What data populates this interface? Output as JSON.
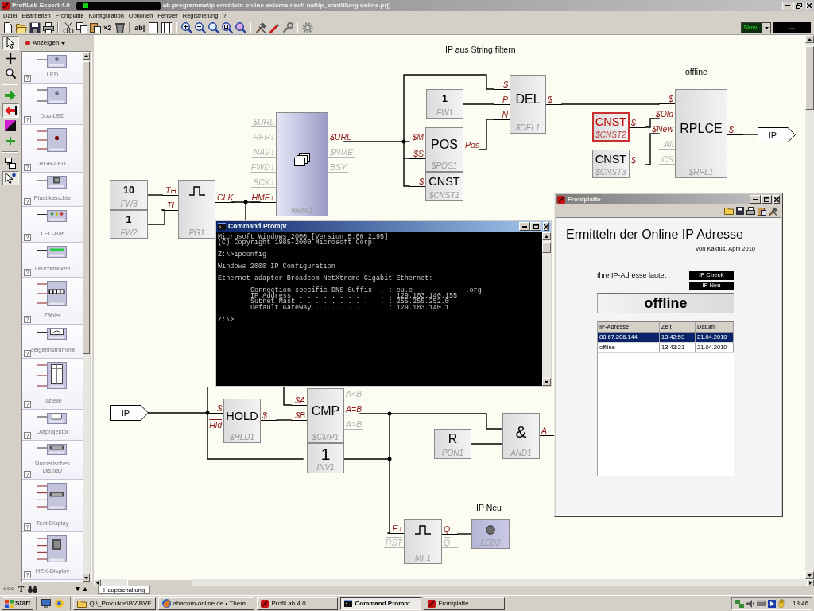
{
  "title_bar": {
    "app_title": "ProfiLab Expert 4.0 -",
    "path": "ab-programme\\ip ermitteln online externe nach nat\\ip_ermittlung online.prj]"
  },
  "menu": [
    "Datei",
    "Bearbeiten",
    "Frontplatte",
    "Konfiguration",
    "Optionen",
    "Fenster",
    "Registrierung",
    "?"
  ],
  "toolbar": {
    "duplicate": "×2",
    "text_tool": "ab|",
    "speed": "Slow",
    "display": "---"
  },
  "tools": [
    {
      "pressed": true
    },
    {
      "pressed": false
    },
    {
      "pressed": false
    },
    {
      "pressed": false
    },
    {
      "pressed": true
    },
    {
      "pressed": false
    },
    {
      "pressed": false
    },
    {
      "pressed": false
    },
    {
      "pressed": true
    }
  ],
  "library": {
    "category": "Anzeigen",
    "items": [
      {
        "label": "LED",
        "kind": "led",
        "help": "?"
      },
      {
        "label": "Duo-LED",
        "kind": "duo-led",
        "help": "?"
      },
      {
        "label": "RGB-LED",
        "kind": "rgb-led",
        "help": "?"
      },
      {
        "label": "Plastikleuchte",
        "kind": "lamp",
        "help": "?"
      },
      {
        "label": "LED-Bar",
        "kind": "led-bar",
        "help": "?"
      },
      {
        "label": "Leuchtbalken",
        "kind": "bar",
        "help": "?"
      },
      {
        "label": "Zähler",
        "kind": "counter",
        "help": "?"
      },
      {
        "label": "Zeigerinstrument",
        "kind": "meter",
        "help": "?"
      },
      {
        "label": "Tabelle",
        "kind": "table",
        "help": "?"
      },
      {
        "label": "Diaprojektor",
        "kind": "projector",
        "help": "?"
      },
      {
        "label": "Numerisches Display",
        "kind": "numeric",
        "help": "?"
      },
      {
        "label": "Text-Display",
        "kind": "text",
        "help": "?"
      },
      {
        "label": "HEX-Display",
        "kind": "hex",
        "help": "?"
      }
    ],
    "collapse": "<<<",
    "text_tool": "T"
  },
  "canvas": {
    "annotations": [
      "IP aus String filtern",
      "offline",
      "IP Neu"
    ],
    "terminals": [
      {
        "label": "IP"
      },
      {
        "label": "IP"
      }
    ],
    "blocks": [
      {
        "kind": "text",
        "title": "10",
        "name": "FW3",
        "selected": false
      },
      {
        "kind": "text",
        "title": "1",
        "name": "FW2",
        "selected": false
      },
      {
        "kind": "pulse",
        "name": "PG1",
        "selected": false,
        "left_pins": [
          {
            "label": "TH",
            "connected": true,
            "inverted": false
          },
          {
            "label": "TL",
            "connected": true,
            "inverted": false
          }
        ],
        "right_pins": [
          {
            "label": "CLK",
            "connected": true,
            "inverted": false
          }
        ]
      },
      {
        "kind": "browser",
        "name": "www1",
        "selected": false,
        "left_pins": [
          {
            "label": "$URL",
            "connected": false,
            "inverted": false
          },
          {
            "label": "RFR↓",
            "connected": false,
            "inverted": false
          },
          {
            "label": "NAV↓",
            "connected": false,
            "inverted": false
          },
          {
            "label": "FWD↓",
            "connected": false,
            "inverted": false
          },
          {
            "label": "BCK↓",
            "connected": false,
            "inverted": false
          },
          {
            "label": "HME↓",
            "connected": true,
            "inverted": false
          }
        ],
        "right_pins": [
          {
            "label": "$URL",
            "connected": true,
            "inverted": false
          },
          {
            "label": "$NME",
            "connected": false,
            "inverted": false
          },
          {
            "label": "BSY",
            "connected": false,
            "inverted": true
          }
        ]
      },
      {
        "kind": "text",
        "title": "1",
        "name": "FW1",
        "selected": false
      },
      {
        "kind": "text",
        "title": "POS",
        "name": "$POS1",
        "selected": false,
        "left_pins": [
          {
            "label": "$M",
            "connected": true,
            "inverted": false
          },
          {
            "label": "$S",
            "connected": true,
            "inverted": false
          }
        ],
        "right_pins": [
          {
            "label": "Pos",
            "connected": true,
            "inverted": false
          }
        ]
      },
      {
        "kind": "text",
        "title": "CNST",
        "name": "$CNST1",
        "selected": false,
        "left_pins": [
          {
            "label": "$",
            "connected": true,
            "inverted": false
          }
        ]
      },
      {
        "kind": "text",
        "title": "DEL",
        "name": "$DEL1",
        "selected": false,
        "left_pins": [
          {
            "label": "$",
            "connected": true,
            "inverted": false
          },
          {
            "label": "P",
            "connected": true,
            "inverted": false
          },
          {
            "label": "N",
            "connected": true,
            "inverted": false
          }
        ],
        "right_pins": [
          {
            "label": "$",
            "connected": true,
            "inverted": false
          }
        ]
      },
      {
        "kind": "text",
        "title": "CNST",
        "name": "$CNST2",
        "selected": true,
        "right_pins": [
          {
            "label": "$",
            "connected": true,
            "inverted": false
          }
        ]
      },
      {
        "kind": "text",
        "title": "CNST",
        "name": "$CNST3",
        "selected": false,
        "right_pins": [
          {
            "label": "$",
            "connected": true,
            "inverted": false
          }
        ]
      },
      {
        "kind": "text",
        "title": "RPLCE",
        "name": "$RPL1",
        "selected": false,
        "left_pins": [
          {
            "label": "$",
            "connected": true,
            "inverted": false
          },
          {
            "label": "$Old",
            "connected": true,
            "inverted": false
          },
          {
            "label": "$New",
            "connected": true,
            "inverted": false
          },
          {
            "label": "All",
            "connected": false,
            "inverted": false
          },
          {
            "label": "CS",
            "connected": false,
            "inverted": false
          }
        ],
        "right_pins": [
          {
            "label": "$",
            "connected": true,
            "inverted": false
          }
        ]
      },
      {
        "kind": "text",
        "title": "HOLD",
        "name": "$HLD1",
        "selected": false,
        "left_pins": [
          {
            "label": "$",
            "connected": true,
            "inverted": false
          },
          {
            "label": "Hld",
            "connected": true,
            "inverted": true
          }
        ],
        "right_pins": [
          {
            "label": "$",
            "connected": true,
            "inverted": false
          }
        ]
      },
      {
        "kind": "text",
        "title": "CMP",
        "name": "$CMP1",
        "selected": false,
        "left_pins": [
          {
            "label": "$A",
            "connected": true,
            "inverted": false
          },
          {
            "label": "$B",
            "connected": true,
            "inverted": false
          }
        ],
        "right_pins": [
          {
            "label": "A<B",
            "connected": false,
            "inverted": false
          },
          {
            "label": "A=B",
            "connected": true,
            "inverted": false
          },
          {
            "label": "A>B",
            "connected": false,
            "inverted": false
          }
        ]
      },
      {
        "kind": "text",
        "title": "1",
        "name": "INV1",
        "selected": false
      },
      {
        "kind": "text",
        "title": "R",
        "name": "PON1",
        "selected": false
      },
      {
        "kind": "text",
        "title": "&",
        "name": "AND1",
        "selected": false,
        "right_pins": [
          {
            "label": "A",
            "connected": true,
            "inverted": false
          }
        ]
      },
      {
        "kind": "pulse",
        "name": "MF1",
        "selected": false,
        "left_pins": [
          {
            "label": "E↓",
            "connected": true,
            "inverted": false
          },
          {
            "label": "RST",
            "connected": false,
            "inverted": true
          }
        ],
        "right_pins": [
          {
            "label": "Q",
            "connected": true,
            "inverted": false
          },
          {
            "label": "Q",
            "connected": false,
            "inverted": true
          }
        ]
      },
      {
        "kind": "led",
        "name": "LED2",
        "selected": false
      }
    ],
    "sheet_tab": "Hauptschaltung"
  },
  "command_prompt": {
    "title": "Command Prompt",
    "paragraphs": [
      {
        "indented": false,
        "lines": [
          "Microsoft Windows 2000 [Version 5.00.2195]",
          "(C) Copyright 1985-2000 Microsoft Corp."
        ]
      },
      {
        "indented": false,
        "lines": [
          "Z:\\>ipconfig"
        ]
      },
      {
        "indented": false,
        "lines": [
          "Windows 2000 IP Configuration"
        ]
      },
      {
        "indented": false,
        "lines": [
          "Ethernet adapter Broadcom NetXtreme Gigabit Ethernet:"
        ]
      },
      {
        "indented": true,
        "lines": [
          "Connection-specific DNS Suffix  . : eu.e             .org",
          "IP Address. . . . . . . . . . . . : 129.103.140.155",
          "Subnet Mask . . . . . . . . . . . : 255.255.252.0",
          "Default Gateway . . . . . . . . . : 129.103.140.1"
        ]
      },
      {
        "indented": false,
        "lines": [
          "Z:\\>"
        ]
      }
    ]
  },
  "frontplatte": {
    "title": "Frontplatte",
    "heading": "Ermitteln der Online IP Adresse",
    "credit": "von Kaktus, April 2010",
    "prompt": "Ihre IP-Adresse lautet :",
    "buttons": [
      "IP Check",
      "IP Neu"
    ],
    "display": "offline",
    "table": {
      "columns": [
        "IP-Adresse",
        "Zeit",
        "Datum"
      ],
      "rows": [
        {
          "selected": true,
          "cells": [
            "88.67.206.144",
            "13:42:59",
            "21.04.2010"
          ]
        },
        {
          "selected": false,
          "cells": [
            "offline",
            "13:43:21",
            "21.04.2010"
          ]
        }
      ]
    }
  },
  "taskbar": {
    "start": "Start",
    "tasks": [
      {
        "label": "Q:\\_Produkte\\BV\\BVE",
        "kind": "folder",
        "selected": false
      },
      {
        "label": "abacom-online.de • Them...",
        "kind": "browser",
        "selected": false
      },
      {
        "label": "ProfiLab 4.0",
        "kind": "profilab",
        "selected": false
      },
      {
        "label": "Command Prompt",
        "kind": "console",
        "selected": true
      },
      {
        "label": "Frontplatte",
        "kind": "profilab",
        "selected": false
      }
    ],
    "clock": "13:46"
  }
}
